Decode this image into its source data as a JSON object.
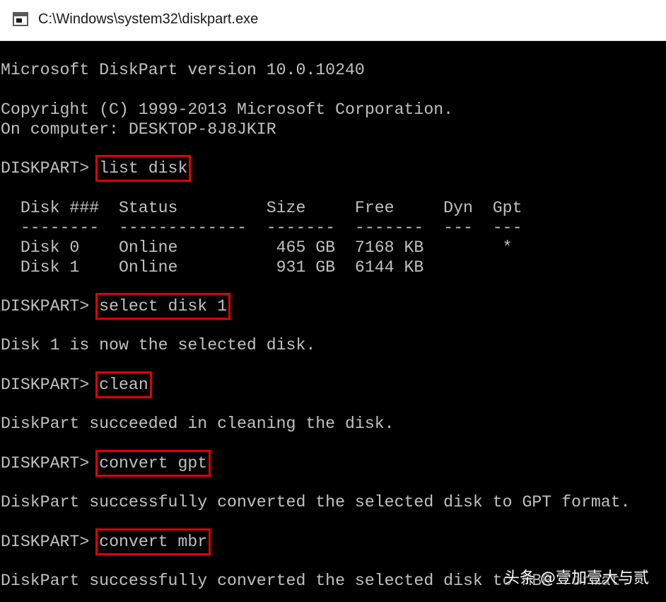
{
  "window": {
    "title": "C:\\Windows\\system32\\diskpart.exe"
  },
  "console": {
    "version_line": "Microsoft DiskPart version 10.0.10240",
    "copyright_line": "Copyright (C) 1999-2013 Microsoft Corporation.",
    "computer_line": "On computer: DESKTOP-8J8JKIR",
    "prompt": "DISKPART> ",
    "commands": {
      "list_disk": "list disk",
      "select_disk": "select disk 1",
      "clean": "clean",
      "convert_gpt": "convert gpt",
      "convert_mbr": "convert mbr"
    },
    "disk_table": {
      "header": "  Disk ###  Status         Size     Free     Dyn  Gpt",
      "separator": "  --------  -------------  -------  -------  ---  ---",
      "rows": [
        "  Disk 0    Online          465 GB  7168 KB        *",
        "  Disk 1    Online          931 GB  6144 KB"
      ]
    },
    "outputs": {
      "select_result": "Disk 1 is now the selected disk.",
      "clean_result": "DiskPart succeeded in cleaning the disk.",
      "gpt_result": "DiskPart successfully converted the selected disk to GPT format.",
      "mbr_result": "DiskPart successfully converted the selected disk to MBR format."
    }
  },
  "watermark": "头条 @壹加壹大与贰",
  "colors": {
    "console_bg": "#000000",
    "console_text": "#c0c0c0",
    "highlight_box": "#e00000",
    "titlebar_bg": "#ffffff"
  }
}
